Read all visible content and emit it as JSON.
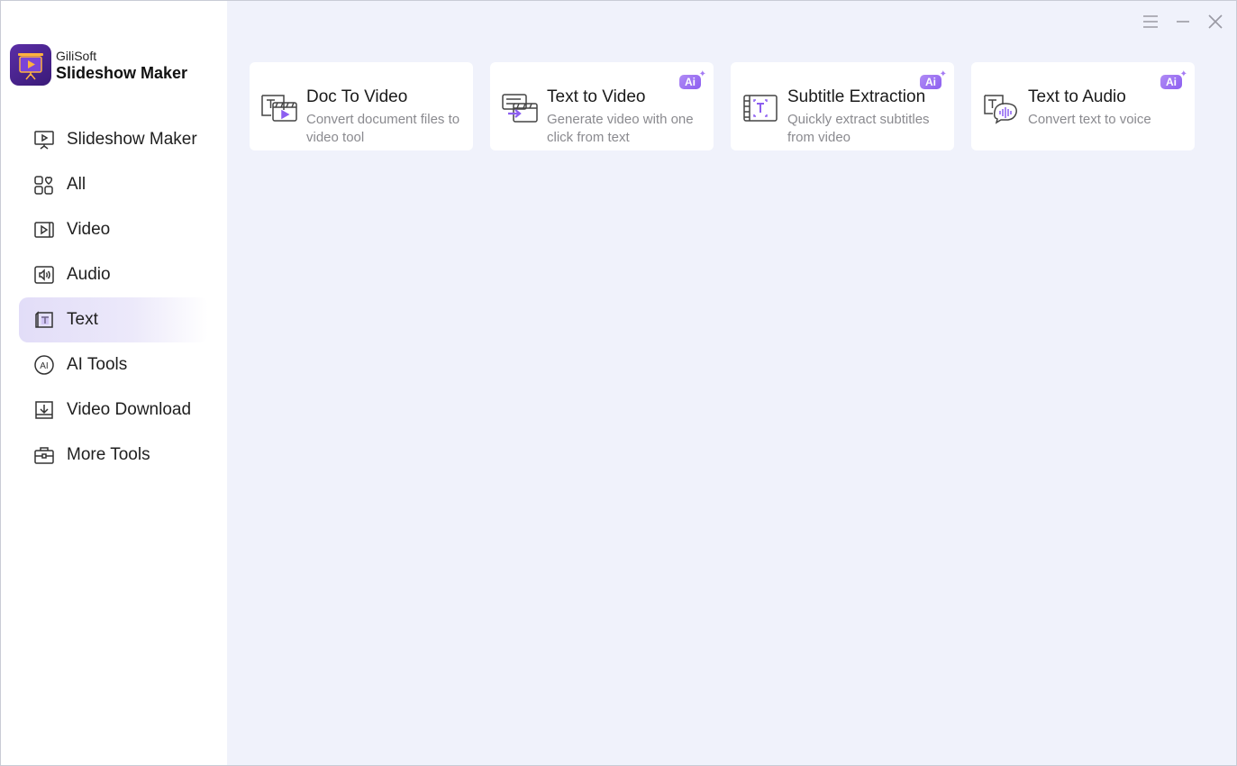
{
  "brand": {
    "company": "GiliSoft",
    "product": "Slideshow Maker"
  },
  "sidebar": {
    "items": [
      {
        "label": "Slideshow Maker",
        "icon": "presentation-icon",
        "active": false
      },
      {
        "label": "All",
        "icon": "grid-icon",
        "active": false
      },
      {
        "label": "Video",
        "icon": "video-icon",
        "active": false
      },
      {
        "label": "Audio",
        "icon": "audio-icon",
        "active": false
      },
      {
        "label": "Text",
        "icon": "text-icon",
        "active": true
      },
      {
        "label": "AI Tools",
        "icon": "ai-icon",
        "active": false
      },
      {
        "label": "Video Download",
        "icon": "download-icon",
        "active": false
      },
      {
        "label": "More Tools",
        "icon": "toolbox-icon",
        "active": false
      }
    ]
  },
  "window_controls": {
    "menu": "menu-icon",
    "minimize": "minimize-icon",
    "close": "close-icon"
  },
  "cards": [
    {
      "title": "Doc To Video",
      "desc": "Convert document files to video tool",
      "icon": "doc-to-video-icon",
      "ai": false
    },
    {
      "title": "Text to Video",
      "desc": "Generate video with one click from text",
      "icon": "text-to-video-icon",
      "ai": true
    },
    {
      "title": "Subtitle Extraction",
      "desc": "Quickly extract subtitles from video",
      "icon": "subtitle-extraction-icon",
      "ai": true
    },
    {
      "title": "Text to Audio",
      "desc": "Convert text to voice",
      "icon": "text-to-audio-icon",
      "ai": true
    }
  ],
  "ai_badge_label": "Ai",
  "colors": {
    "accent": "#8c5ef0",
    "active_bg": "#e2ddf8",
    "content_bg": "#f0f2fb"
  }
}
